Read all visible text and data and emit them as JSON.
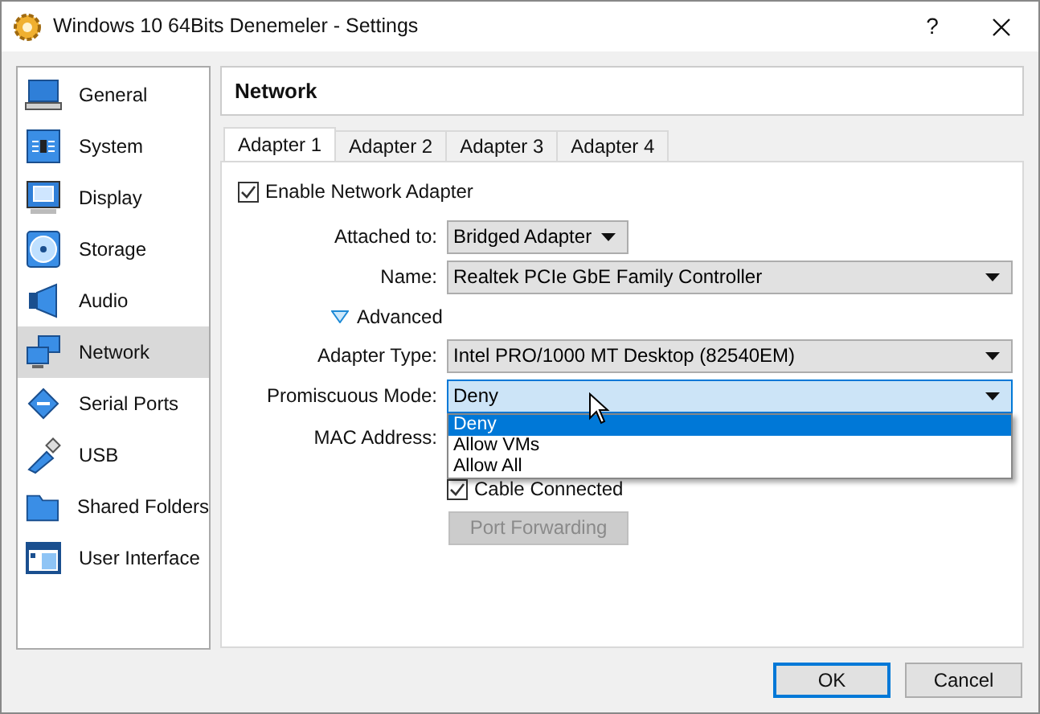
{
  "window": {
    "title": "Windows 10 64Bits Denemeler - Settings",
    "help": "?"
  },
  "sidebar": {
    "items": [
      {
        "label": "General",
        "selected": false
      },
      {
        "label": "System",
        "selected": false
      },
      {
        "label": "Display",
        "selected": false
      },
      {
        "label": "Storage",
        "selected": false
      },
      {
        "label": "Audio",
        "selected": false
      },
      {
        "label": "Network",
        "selected": true
      },
      {
        "label": "Serial Ports",
        "selected": false
      },
      {
        "label": "USB",
        "selected": false
      },
      {
        "label": "Shared Folders",
        "selected": false
      },
      {
        "label": "User Interface",
        "selected": false
      }
    ]
  },
  "page_title": "Network",
  "tabs": [
    {
      "label": "Adapter 1",
      "selected": true
    },
    {
      "label": "Adapter 2",
      "selected": false
    },
    {
      "label": "Adapter 3",
      "selected": false
    },
    {
      "label": "Adapter 4",
      "selected": false
    }
  ],
  "enable_adapter": {
    "label": "Enable Network Adapter",
    "checked": true
  },
  "attached_to": {
    "label": "Attached to:",
    "value": "Bridged Adapter"
  },
  "name": {
    "label": "Name:",
    "value": "Realtek PCIe GbE Family Controller"
  },
  "advanced": {
    "label": "Advanced",
    "expanded": true
  },
  "adapter_type": {
    "label": "Adapter Type:",
    "value": "Intel PRO/1000 MT Desktop (82540EM)"
  },
  "promiscuous_mode": {
    "label": "Promiscuous Mode:",
    "value": "Deny",
    "open": true,
    "options": [
      {
        "label": "Deny",
        "selected": true
      },
      {
        "label": "Allow VMs",
        "selected": false
      },
      {
        "label": "Allow All",
        "selected": false
      }
    ]
  },
  "mac_address": {
    "label": "MAC Address:"
  },
  "cable_connected": {
    "label": "Cable Connected",
    "checked": true
  },
  "port_forwarding": {
    "label": "Port Forwarding",
    "disabled": true
  },
  "buttons": [
    {
      "label": "OK",
      "default": true
    },
    {
      "label": "Cancel",
      "default": false
    }
  ]
}
